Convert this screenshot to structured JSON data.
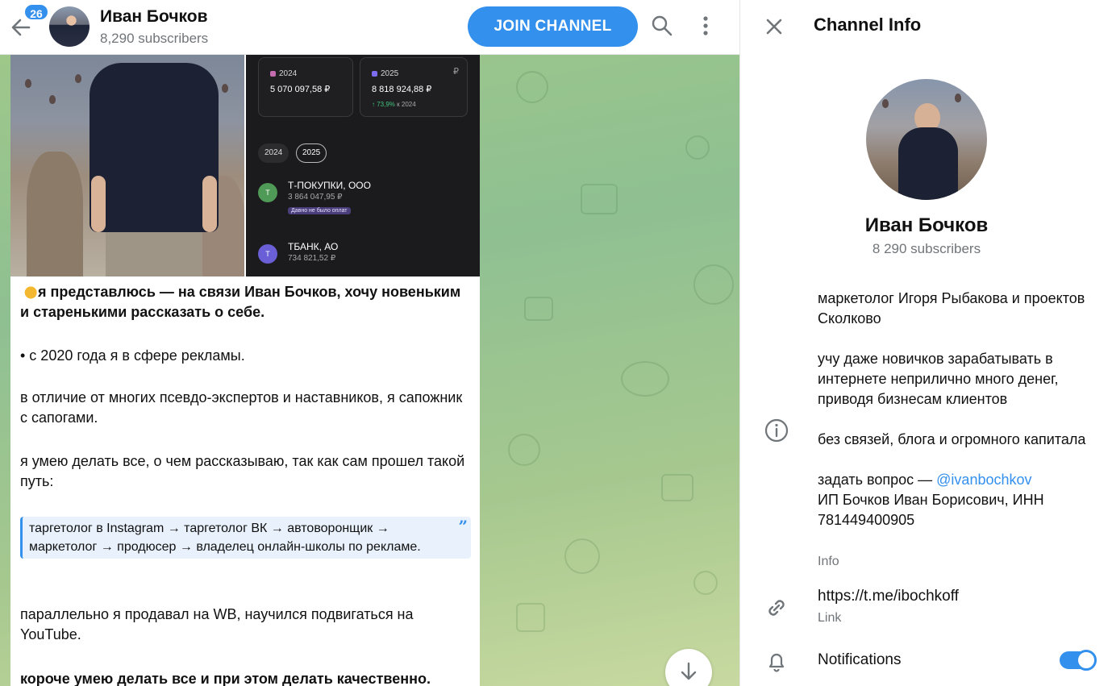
{
  "header": {
    "unread_count": "26",
    "channel_name": "Иван Бочков",
    "subscribers": "8,290 subscribers",
    "join_label": "JOIN CHANNEL"
  },
  "bank_screenshot": {
    "cards": [
      {
        "year": "2024",
        "amount": "5 070 097,58 ₽",
        "color": "#c56bb0"
      },
      {
        "year": "2025",
        "amount": "8 818 924,88 ₽",
        "delta_pct": "↑ 73,9%",
        "delta_suffix": "к 2024",
        "currency": "₽",
        "color": "#7b6cf0"
      }
    ],
    "year_chips": [
      "2024",
      "2025"
    ],
    "rows": [
      {
        "icon_letter": "Т",
        "name": "Т-ПОКУПКИ, ООО",
        "value": "3 864 047,95 ₽",
        "tag": "Давно не было оплат",
        "color": "#4f9a57"
      },
      {
        "icon_letter": "Т",
        "name": "ТБАНК, АО",
        "value": "734 821,52 ₽",
        "color": "#6a5fd6"
      }
    ]
  },
  "message": {
    "intro": "я представлюсь — на связи Иван Бочков, хочу новеньким и старенькими рассказать о себе.",
    "p1": "• с 2020 года я в сфере рекламы.",
    "p2": "в отличие от многих псевдо-экспертов и наставников, я сапожник с сапогами.",
    "p3": "я умею делать все, о чем рассказываю, так как сам прошел такой путь:",
    "quote": "таргетолог в Instagram → таргетолог ВК → автоворонщик → маркетолог → продюсер → владелец онлайн-школы по рекламе.",
    "p4": "параллельно я продавал на WB, научился подвигаться на YouTube.",
    "p5": "короче умею делать все и при этом делать качественно."
  },
  "info_panel": {
    "title": "Channel Info",
    "name": "Иван Бочков",
    "subscribers": "8 290 subscribers",
    "description": [
      "маркетолог Игоря Рыбакова и проектов Сколково",
      "учу даже новичков зарабатывать в интернете неприлично много денег, приводя бизнесам клиентов",
      "без связей, блога и огромного капитала"
    ],
    "ask_prefix": "задать вопрос — ",
    "ask_handle": "@ivanbochkov",
    "legal": "ИП Бочков Иван Борисович, ИНН 781449400905",
    "info_label": "Info",
    "link": "https://t.me/ibochkoff",
    "link_label": "Link",
    "notifications_label": "Notifications",
    "notifications_on": true
  },
  "colors": {
    "accent": "#3390ec",
    "secondary_text": "#707579",
    "chat_bg": "#9ec78a"
  },
  "icons": [
    "back-arrow-icon",
    "search-icon",
    "more-vertical-icon",
    "arrow-down-icon",
    "close-icon",
    "info-icon",
    "link-icon",
    "bell-icon"
  ]
}
